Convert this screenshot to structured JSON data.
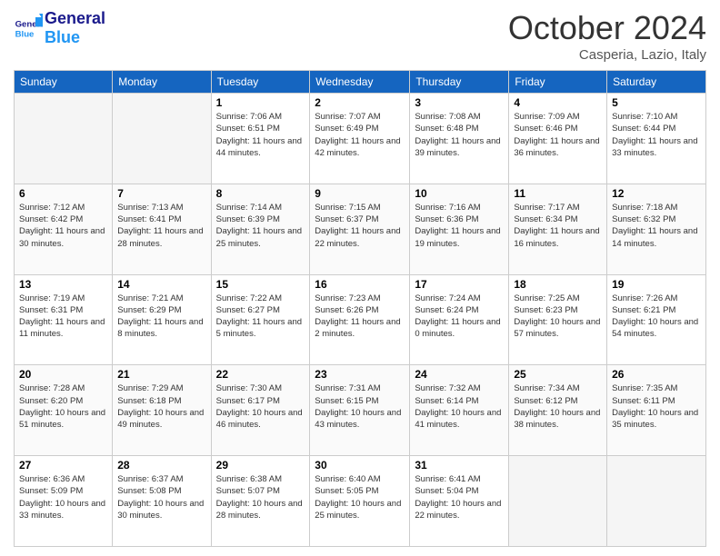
{
  "header": {
    "logo_general": "General",
    "logo_blue": "Blue",
    "month": "October 2024",
    "location": "Casperia, Lazio, Italy"
  },
  "weekdays": [
    "Sunday",
    "Monday",
    "Tuesday",
    "Wednesday",
    "Thursday",
    "Friday",
    "Saturday"
  ],
  "weeks": [
    [
      {
        "day": "",
        "info": ""
      },
      {
        "day": "",
        "info": ""
      },
      {
        "day": "1",
        "info": "Sunrise: 7:06 AM\nSunset: 6:51 PM\nDaylight: 11 hours and 44 minutes."
      },
      {
        "day": "2",
        "info": "Sunrise: 7:07 AM\nSunset: 6:49 PM\nDaylight: 11 hours and 42 minutes."
      },
      {
        "day": "3",
        "info": "Sunrise: 7:08 AM\nSunset: 6:48 PM\nDaylight: 11 hours and 39 minutes."
      },
      {
        "day": "4",
        "info": "Sunrise: 7:09 AM\nSunset: 6:46 PM\nDaylight: 11 hours and 36 minutes."
      },
      {
        "day": "5",
        "info": "Sunrise: 7:10 AM\nSunset: 6:44 PM\nDaylight: 11 hours and 33 minutes."
      }
    ],
    [
      {
        "day": "6",
        "info": "Sunrise: 7:12 AM\nSunset: 6:42 PM\nDaylight: 11 hours and 30 minutes."
      },
      {
        "day": "7",
        "info": "Sunrise: 7:13 AM\nSunset: 6:41 PM\nDaylight: 11 hours and 28 minutes."
      },
      {
        "day": "8",
        "info": "Sunrise: 7:14 AM\nSunset: 6:39 PM\nDaylight: 11 hours and 25 minutes."
      },
      {
        "day": "9",
        "info": "Sunrise: 7:15 AM\nSunset: 6:37 PM\nDaylight: 11 hours and 22 minutes."
      },
      {
        "day": "10",
        "info": "Sunrise: 7:16 AM\nSunset: 6:36 PM\nDaylight: 11 hours and 19 minutes."
      },
      {
        "day": "11",
        "info": "Sunrise: 7:17 AM\nSunset: 6:34 PM\nDaylight: 11 hours and 16 minutes."
      },
      {
        "day": "12",
        "info": "Sunrise: 7:18 AM\nSunset: 6:32 PM\nDaylight: 11 hours and 14 minutes."
      }
    ],
    [
      {
        "day": "13",
        "info": "Sunrise: 7:19 AM\nSunset: 6:31 PM\nDaylight: 11 hours and 11 minutes."
      },
      {
        "day": "14",
        "info": "Sunrise: 7:21 AM\nSunset: 6:29 PM\nDaylight: 11 hours and 8 minutes."
      },
      {
        "day": "15",
        "info": "Sunrise: 7:22 AM\nSunset: 6:27 PM\nDaylight: 11 hours and 5 minutes."
      },
      {
        "day": "16",
        "info": "Sunrise: 7:23 AM\nSunset: 6:26 PM\nDaylight: 11 hours and 2 minutes."
      },
      {
        "day": "17",
        "info": "Sunrise: 7:24 AM\nSunset: 6:24 PM\nDaylight: 11 hours and 0 minutes."
      },
      {
        "day": "18",
        "info": "Sunrise: 7:25 AM\nSunset: 6:23 PM\nDaylight: 10 hours and 57 minutes."
      },
      {
        "day": "19",
        "info": "Sunrise: 7:26 AM\nSunset: 6:21 PM\nDaylight: 10 hours and 54 minutes."
      }
    ],
    [
      {
        "day": "20",
        "info": "Sunrise: 7:28 AM\nSunset: 6:20 PM\nDaylight: 10 hours and 51 minutes."
      },
      {
        "day": "21",
        "info": "Sunrise: 7:29 AM\nSunset: 6:18 PM\nDaylight: 10 hours and 49 minutes."
      },
      {
        "day": "22",
        "info": "Sunrise: 7:30 AM\nSunset: 6:17 PM\nDaylight: 10 hours and 46 minutes."
      },
      {
        "day": "23",
        "info": "Sunrise: 7:31 AM\nSunset: 6:15 PM\nDaylight: 10 hours and 43 minutes."
      },
      {
        "day": "24",
        "info": "Sunrise: 7:32 AM\nSunset: 6:14 PM\nDaylight: 10 hours and 41 minutes."
      },
      {
        "day": "25",
        "info": "Sunrise: 7:34 AM\nSunset: 6:12 PM\nDaylight: 10 hours and 38 minutes."
      },
      {
        "day": "26",
        "info": "Sunrise: 7:35 AM\nSunset: 6:11 PM\nDaylight: 10 hours and 35 minutes."
      }
    ],
    [
      {
        "day": "27",
        "info": "Sunrise: 6:36 AM\nSunset: 5:09 PM\nDaylight: 10 hours and 33 minutes."
      },
      {
        "day": "28",
        "info": "Sunrise: 6:37 AM\nSunset: 5:08 PM\nDaylight: 10 hours and 30 minutes."
      },
      {
        "day": "29",
        "info": "Sunrise: 6:38 AM\nSunset: 5:07 PM\nDaylight: 10 hours and 28 minutes."
      },
      {
        "day": "30",
        "info": "Sunrise: 6:40 AM\nSunset: 5:05 PM\nDaylight: 10 hours and 25 minutes."
      },
      {
        "day": "31",
        "info": "Sunrise: 6:41 AM\nSunset: 5:04 PM\nDaylight: 10 hours and 22 minutes."
      },
      {
        "day": "",
        "info": ""
      },
      {
        "day": "",
        "info": ""
      }
    ]
  ]
}
